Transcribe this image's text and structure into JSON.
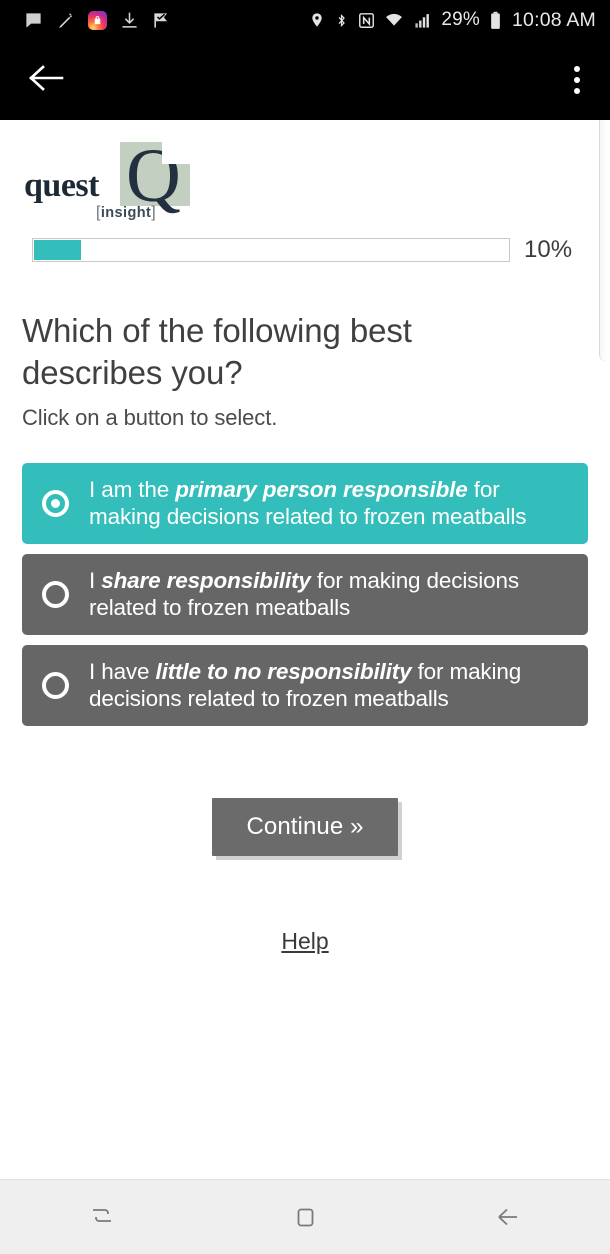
{
  "statusbar": {
    "left_icons": [
      "message-icon",
      "carrot-icon",
      "shopping-bag-icon",
      "download-icon",
      "checkmark-flag-icon"
    ],
    "right_icons": [
      "location-icon",
      "bluetooth-icon",
      "nfc-icon",
      "wifi-icon",
      "cellular-signal-icon"
    ],
    "battery_percent": "29%",
    "clock": "10:08 AM"
  },
  "appbar": {
    "back_label": "Back",
    "overflow_label": "More options"
  },
  "logo": {
    "wordmark": "quest",
    "mark_letter": "Q",
    "tagline": "insight",
    "bracket_open": "[",
    "bracket_close": "]",
    "square_color": "#c3cfc0",
    "glyph_color": "#22303f"
  },
  "progress": {
    "percent": 10,
    "label": "10%",
    "fill_color": "#33bdbb",
    "track_color": "#ffffff"
  },
  "survey": {
    "question": "Which of the following best describes you?",
    "instruction": "Click on a button to select.",
    "options": [
      {
        "id": "primary",
        "prefix": "I am the ",
        "emphasis": "primary person responsible",
        "suffix": " for making decisions related to frozen meatballs",
        "selected": true,
        "bg_color": "#33bdbb"
      },
      {
        "id": "shared",
        "prefix": "I ",
        "emphasis": "share responsibility",
        "suffix": " for making decisions related to frozen meatballs",
        "selected": false,
        "bg_color": "#666666"
      },
      {
        "id": "little-none",
        "prefix": "I have ",
        "emphasis": "little to no responsibility",
        "suffix": " for making decisions related to frozen meatballs",
        "selected": false,
        "bg_color": "#666666"
      }
    ],
    "continue_label": "Continue »",
    "help_label": "Help"
  },
  "navbar": {
    "recents_label": "Recents",
    "home_label": "Home",
    "back_label": "Back"
  }
}
